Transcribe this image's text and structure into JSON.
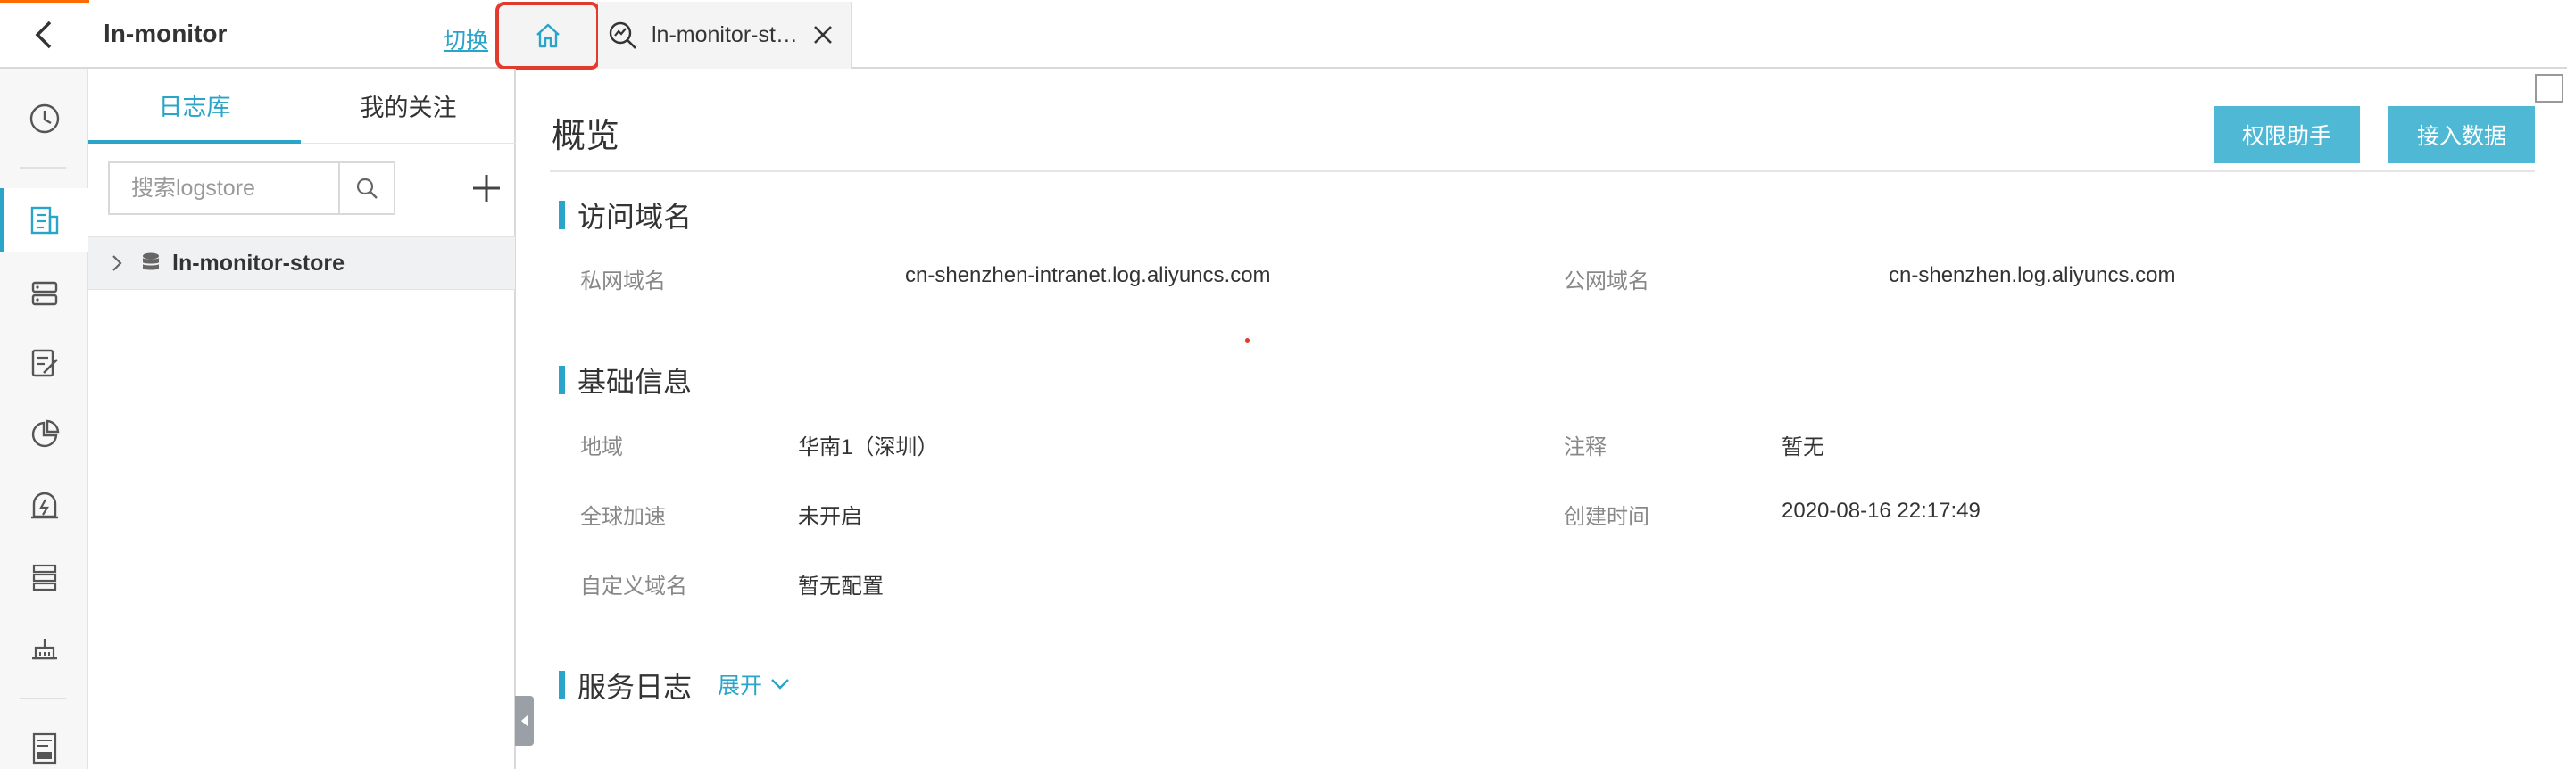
{
  "header": {
    "project_title": "ln-monitor",
    "switch_label": "切换",
    "tabs": [
      {
        "icon": "home-icon"
      },
      {
        "icon": "search-chart-icon",
        "label": "ln-monitor-st…"
      }
    ]
  },
  "rail": {
    "items": [
      {
        "icon": "clock-icon"
      },
      {
        "icon": "logstore-icon",
        "active": true
      },
      {
        "icon": "storage-icon"
      },
      {
        "icon": "saved-search-icon"
      },
      {
        "icon": "dashboard-icon"
      },
      {
        "icon": "alert-icon"
      },
      {
        "icon": "machine-group-icon"
      },
      {
        "icon": "etl-icon"
      },
      {
        "icon": "sql-icon"
      }
    ]
  },
  "panel": {
    "tabs": [
      "日志库",
      "我的关注"
    ],
    "search_placeholder": "搜索logstore",
    "stores": [
      {
        "name": "ln-monitor-store"
      }
    ]
  },
  "main": {
    "title": "概览",
    "buttons": {
      "permission": "权限助手",
      "ingest": "接入数据"
    },
    "domain_section": {
      "title": "访问域名",
      "private_label": "私网域名",
      "private_value": "cn-shenzhen-intranet.log.aliyuncs.com",
      "public_label": "公网域名",
      "public_value": "cn-shenzhen.log.aliyuncs.com"
    },
    "basic_section": {
      "title": "基础信息",
      "region_label": "地域",
      "region_value": "华南1（深圳）",
      "note_label": "注释",
      "note_value": "暂无",
      "acceleration_label": "全球加速",
      "acceleration_value": "未开启",
      "created_label": "创建时间",
      "created_value": "2020-08-16 22:17:49",
      "custom_domain_label": "自定义域名",
      "custom_domain_value": "暂无配置"
    },
    "service_log_section": {
      "title": "服务日志",
      "expand_label": "展开"
    }
  },
  "colors": {
    "accent": "#2aa4c8",
    "button": "#4fb8d4",
    "highlight": "#e23b2e"
  }
}
